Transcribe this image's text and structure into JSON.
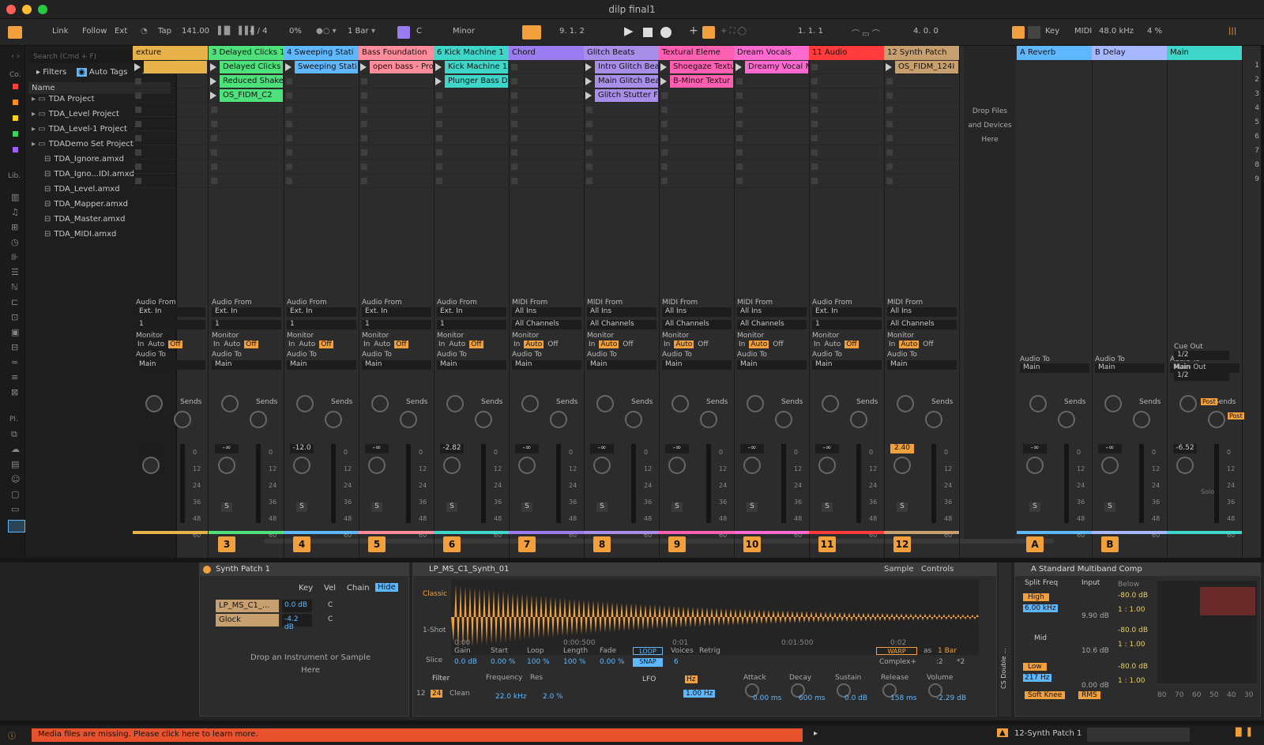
{
  "window": {
    "title": "dilp final1"
  },
  "control": {
    "link": "Link",
    "follow": "Follow",
    "ext": "Ext",
    "tap": "Tap",
    "tempo": "141.00",
    "signature": "4 / 4",
    "swing": "0%",
    "quantize": "1 Bar",
    "key": "C",
    "scale": "Minor",
    "position": "9.   1.   2",
    "loop_start": "1.   1.   1",
    "loop_length": "4.   0.   0",
    "key_map": "Key",
    "midi_map": "MIDI",
    "sample_rate": "48.0 kHz",
    "cpu": "4 %"
  },
  "browser": {
    "search_placeholder": "Search (Cmd + F)",
    "filters": "Filters",
    "auto_tags": "Auto Tags",
    "edit": "Edit",
    "name_header": "Name",
    "side_labels": [
      "Co.",
      "Lib.",
      "Pl."
    ],
    "items": [
      "TDA Project",
      "TDA_Level Project",
      "TDA_Level-1 Project",
      "TDADemo Set Project",
      "TDA_Ignore.amxd",
      "TDA_Igno...IDI.amxd",
      "TDA_Level.amxd",
      "TDA_Mapper.amxd",
      "TDA_Master.amxd",
      "TDA_MIDI.amxd"
    ]
  },
  "labels": {
    "audio_from": "Audio From",
    "midi_from": "MIDI From",
    "monitor": "Monitor",
    "audio_to": "Audio To",
    "sends": "Sends",
    "in": "In",
    "auto": "Auto",
    "off": "Off",
    "main": "Main",
    "ext_in": "Ext. In",
    "all_ins": "All Ins",
    "all_channels": "All Channels",
    "ch1": "1",
    "s": "S",
    "send_a": "A",
    "send_b": "B",
    "drop": "Drop Files and Devices Here",
    "cue_out": "Cue Out",
    "main_out": "Main Out",
    "half": "1/2",
    "post": "Post",
    "solo": "Solo",
    "scale_marks": [
      "0",
      "12",
      "24",
      "36",
      "48",
      "60"
    ]
  },
  "tracks": [
    {
      "name": "exture",
      "color": "#e8b24a",
      "clips": [
        {
          "row": 0,
          "name": ""
        }
      ],
      "num": "",
      "vol": "",
      "io": "partial",
      "bottom": "4"
    },
    {
      "name": "3 Delayed Clicks 1",
      "color": "#4ee07a",
      "clips": [
        {
          "row": 0,
          "name": "Delayed Clicks"
        },
        {
          "row": 1,
          "name": "Reduced Shake"
        },
        {
          "row": 2,
          "name": "OS_FIDM_C2"
        }
      ],
      "num": "3",
      "vol": "-∞",
      "io": "audio"
    },
    {
      "name": "4 Sweeping Stati",
      "color": "#5fb8ff",
      "clips": [
        {
          "row": 0,
          "name": "Sweeping Stati"
        }
      ],
      "num": "4",
      "vol": "-12.0",
      "io": "audio",
      "bottom": "5   8"
    },
    {
      "name": "Bass Foundation",
      "color": "#ff8c9a",
      "clips": [
        {
          "row": 0,
          "name": "open bass - Pro"
        }
      ],
      "num": "5",
      "vol": "-∞",
      "io": "audio"
    },
    {
      "name": "6 Kick Machine 1",
      "color": "#3ed6c8",
      "clips": [
        {
          "row": 0,
          "name": "Kick Machine 1"
        },
        {
          "row": 1,
          "name": "Plunger Bass D"
        }
      ],
      "num": "6",
      "vol": "-2.82",
      "io": "audio",
      "bottom": "3   16"
    },
    {
      "name": "Chord",
      "color": "#9b7cf0",
      "clips": [],
      "num": "7",
      "vol": "-∞",
      "io": "midi"
    },
    {
      "name": "Glitch Beats",
      "color": "#a88ee8",
      "clips": [
        {
          "row": 0,
          "name": "Intro Glitch Bea"
        },
        {
          "row": 1,
          "name": "Main Glitch Bea"
        },
        {
          "row": 2,
          "name": "Glitch Stutter F"
        }
      ],
      "num": "8",
      "vol": "-∞",
      "io": "midi"
    },
    {
      "name": "Textural Eleme",
      "color": "#ff5fb0",
      "clips": [
        {
          "row": 0,
          "name": "Shoegaze Textu"
        },
        {
          "row": 1,
          "name": "B-Minor Textur"
        }
      ],
      "num": "9",
      "vol": "-∞",
      "io": "midi"
    },
    {
      "name": "Dream Vocals",
      "color": "#ff6ad0",
      "clips": [
        {
          "row": 0,
          "name": "Dreamy Vocal M"
        }
      ],
      "num": "10",
      "vol": "-∞",
      "io": "midi"
    },
    {
      "name": "11 Audio",
      "color": "#ff3b3b",
      "clips": [],
      "num": "11",
      "vol": "-∞",
      "io": "audio"
    },
    {
      "name": "12 Synth Patch",
      "color": "#c8a070",
      "clips": [
        {
          "row": 0,
          "name": "OS_FIDM_124I"
        }
      ],
      "num": "12",
      "vol": "2.40",
      "io": "midi",
      "bottom": "2   32"
    }
  ],
  "returns": [
    {
      "name": "A Reverb",
      "color": "#5fb8ff",
      "num": "A",
      "vol": "-∞"
    },
    {
      "name": "B Delay",
      "color": "#a8b8ff",
      "num": "B",
      "vol": "-∞"
    },
    {
      "name": "Main",
      "color": "#3ed6c8",
      "num": "",
      "vol": "-6.52"
    }
  ],
  "scenes": [
    "1",
    "2",
    "3",
    "4",
    "5",
    "6",
    "7",
    "8",
    "9"
  ],
  "devices": {
    "rack": {
      "title": "Synth Patch 1",
      "key": "Key",
      "vel": "Vel",
      "chain": "Chain",
      "hide": "Hide",
      "chains": [
        {
          "name": "LP_MS_C1_...",
          "vol": "0.0 dB",
          "pan": "C"
        },
        {
          "name": "Glock",
          "vol": "-4.2 dB",
          "pan": "C"
        }
      ],
      "drop": "Drop an Instrument or Sample Here"
    },
    "simpler": {
      "title": "LP_MS_C1_Synth_01",
      "sample": "Sample",
      "controls": "Controls",
      "mode": "Classic",
      "oneshot": "1-Shot",
      "slice": "Slice",
      "timeline": [
        "0:00",
        "0:00:500",
        "0:01",
        "0:01:500",
        "0:02"
      ],
      "params": [
        {
          "l": "Gain",
          "v": "0.0 dB"
        },
        {
          "l": "Start",
          "v": "0.00 %"
        },
        {
          "l": "Loop",
          "v": "100 %"
        },
        {
          "l": "Length",
          "v": "100 %"
        },
        {
          "l": "Fade",
          "v": "0.00 %"
        }
      ],
      "loop": "LOOP",
      "snap": "SNAP",
      "voices_l": "Voices",
      "voices": "6",
      "retrig": "Retrig",
      "warp": "WARP",
      "as": "as",
      "bar": "1 Bar",
      "complex": "Complex+",
      "half": ":2",
      "dbl": "*2",
      "filter": "Filter",
      "frequency": "Frequency",
      "res": "Res",
      "f12": "12",
      "f24": "24",
      "clean": "Clean",
      "freq_v": "22.0 kHz",
      "res_v": "2.0 %",
      "lfo": "LFO",
      "hz": "Hz",
      "lfo_v": "1.00 Hz",
      "env": [
        {
          "l": "Attack",
          "v": "0.00 ms"
        },
        {
          "l": "Decay",
          "v": "600 ms"
        },
        {
          "l": "Sustain",
          "v": "0.0 dB"
        },
        {
          "l": "Release",
          "v": "158 ms"
        },
        {
          "l": "Volume",
          "v": "-2.29 dB"
        }
      ]
    },
    "side_label": "CS Double ...",
    "comp": {
      "title": "A Standard Multiband Comp",
      "split": "Split Freq",
      "input": "Input",
      "below": "Below",
      "high": "High",
      "mid": "Mid",
      "low": "Low",
      "high_f": "6.00 kHz",
      "low_f": "217 Hz",
      "in_high": "9.90 dB",
      "in_mid": "10.6 dB",
      "in_low": "0.00 dB",
      "thr": "-80.0 dB",
      "ratio": "1 : 1.00",
      "soft": "Soft Knee",
      "rms": "RMS",
      "axis": [
        "80",
        "70",
        "60",
        "50",
        "40",
        "30"
      ]
    }
  },
  "status": {
    "message": "Media files are missing. Please click here to learn more.",
    "track": "12-Synth Patch 1"
  }
}
